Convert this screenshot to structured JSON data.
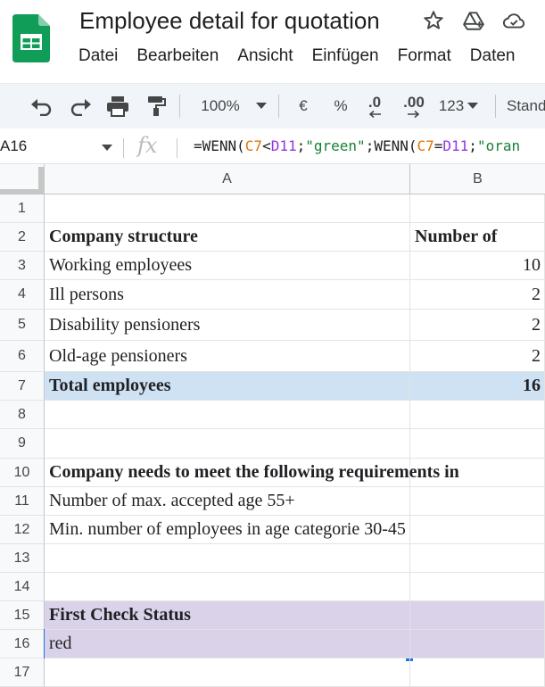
{
  "app": {
    "title": "Employee detail for quotation",
    "menu": [
      "Datei",
      "Bearbeiten",
      "Ansicht",
      "Einfügen",
      "Format",
      "Daten"
    ]
  },
  "toolbar": {
    "zoom": "100%",
    "currency": "€",
    "percent": "%",
    "decrease_decimals": ".0",
    "increase_decimals": ".00",
    "number_format": "123",
    "font": "Standard"
  },
  "formula_bar": {
    "name_box": "A16",
    "fx": "fx",
    "formula_parts": [
      {
        "text": "=WENN(",
        "kind": "plain"
      },
      {
        "text": "C7",
        "kind": "orange"
      },
      {
        "text": "<",
        "kind": "plain"
      },
      {
        "text": "D11",
        "kind": "purple"
      },
      {
        "text": ";",
        "kind": "plain"
      },
      {
        "text": "\"green\"",
        "kind": "green"
      },
      {
        "text": ";WENN(",
        "kind": "plain"
      },
      {
        "text": "C7",
        "kind": "orange"
      },
      {
        "text": "=",
        "kind": "plain"
      },
      {
        "text": "D11",
        "kind": "purple"
      },
      {
        "text": ";",
        "kind": "plain"
      },
      {
        "text": "\"oran",
        "kind": "green"
      }
    ]
  },
  "grid": {
    "columns": [
      "A",
      "B"
    ],
    "rows": [
      {
        "num": "1",
        "a": "",
        "b": "",
        "style": ""
      },
      {
        "num": "2",
        "a": "Company structure",
        "b": "Number of",
        "style": "bold"
      },
      {
        "num": "3",
        "a": "Working employees",
        "b": "10",
        "style": ""
      },
      {
        "num": "4",
        "a": "Ill persons",
        "b": "2",
        "style": ""
      },
      {
        "num": "5",
        "a": "Disability pensioners",
        "b": "2",
        "style": ""
      },
      {
        "num": "6",
        "a": "Old-age pensioners",
        "b": "2",
        "style": ""
      },
      {
        "num": "7",
        "a": "Total employees",
        "b": "16",
        "style": "bold blue"
      },
      {
        "num": "8",
        "a": "",
        "b": "",
        "style": ""
      },
      {
        "num": "9",
        "a": "",
        "b": "",
        "style": ""
      },
      {
        "num": "10",
        "a": "Company needs to meet the following requirements in",
        "b": "",
        "style": "bold"
      },
      {
        "num": "11",
        "a": "Number of max. accepted age 55+",
        "b": "",
        "style": ""
      },
      {
        "num": "12",
        "a": "Min. number of employees in age categorie 30-45",
        "b": "",
        "style": ""
      },
      {
        "num": "13",
        "a": "",
        "b": "",
        "style": ""
      },
      {
        "num": "14",
        "a": "",
        "b": "",
        "style": ""
      },
      {
        "num": "15",
        "a": "First Check Status",
        "b": "",
        "style": "bold purple"
      },
      {
        "num": "16",
        "a": "red",
        "b": "",
        "style": "purple"
      },
      {
        "num": "17",
        "a": "",
        "b": "",
        "style": ""
      }
    ]
  },
  "colors": {
    "selection": "#1a73e8",
    "total_row": "#cfe2f3",
    "status_rows": "#d9d2e9"
  }
}
